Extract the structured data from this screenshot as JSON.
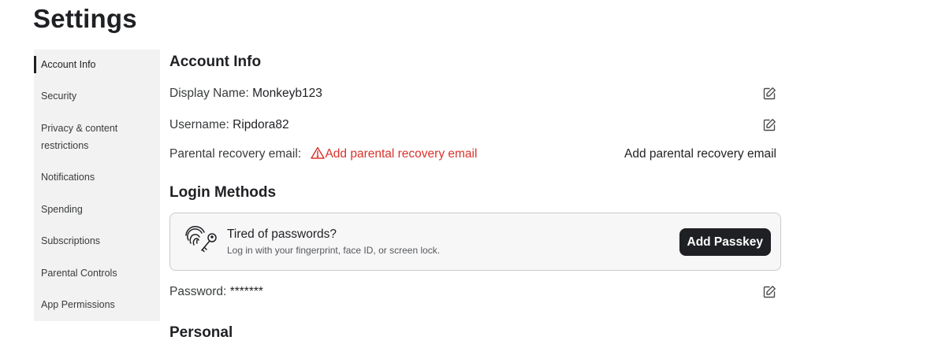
{
  "page": {
    "title": "Settings"
  },
  "sidebar": {
    "items": [
      {
        "label": "Account Info",
        "active": true
      },
      {
        "label": "Security"
      },
      {
        "label": "Privacy & content restrictions"
      },
      {
        "label": "Notifications"
      },
      {
        "label": "Spending"
      },
      {
        "label": "Subscriptions"
      },
      {
        "label": "Parental Controls"
      },
      {
        "label": "App Permissions"
      }
    ]
  },
  "account_info": {
    "heading": "Account Info",
    "display_name_label": "Display Name:",
    "display_name_value": "Monkeyb123",
    "username_label": "Username:",
    "username_value": "Ripdora82",
    "parental_email_label": "Parental recovery email:",
    "parental_email_warning": "Add parental recovery email",
    "parental_email_action": "Add parental recovery email"
  },
  "login_methods": {
    "heading": "Login Methods",
    "passkey_title": "Tired of passwords?",
    "passkey_subtitle": "Log in with your fingerprint, face ID, or screen lock.",
    "passkey_button": "Add Passkey",
    "password_label": "Password:",
    "password_value": "*******"
  },
  "personal": {
    "heading": "Personal"
  },
  "icons": {
    "edit": "edit-icon",
    "warning": "warning-triangle-icon",
    "passkey": "fingerprint-key-icon"
  },
  "colors": {
    "text": "#1f2023",
    "warning": "#d9322b",
    "sidebar_bg": "#f2f2f2",
    "button_bg": "#1f2023"
  }
}
